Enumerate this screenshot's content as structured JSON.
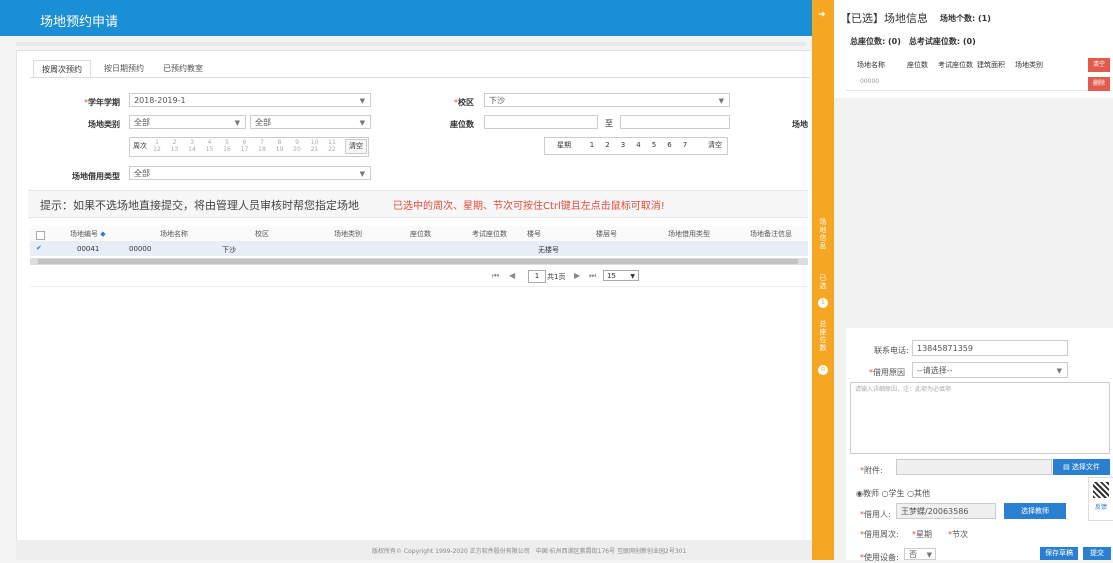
{
  "header": {
    "title": "场地预约申请"
  },
  "tabs": [
    "按周次预约",
    "按日期预约",
    "已预约教室"
  ],
  "form": {
    "semester_label": "学年学期",
    "semester_value": "2018-2019-1",
    "campus_label": "校区",
    "campus_value": "下沙",
    "venue_type_label": "场地类别",
    "venue_type_value1": "全部",
    "venue_type_value2": "全部",
    "seats_label": "座位数",
    "seats_to": "至",
    "venue_cut_label": "场地",
    "week_label": "周次",
    "week_row1": [
      "1",
      "2",
      "3",
      "4",
      "5",
      "6",
      "7",
      "8",
      "9",
      "10",
      "11"
    ],
    "week_row2": [
      "12",
      "13",
      "14",
      "15",
      "16",
      "17",
      "18",
      "19",
      "20",
      "21",
      "22"
    ],
    "week_clear": "清空",
    "weekday_label": "星期",
    "weekdays": [
      "1",
      "2",
      "3",
      "4",
      "5",
      "6",
      "7"
    ],
    "weekday_clear": "清空",
    "usage_type_label": "场地借用类型",
    "usage_type_value": "全部"
  },
  "hints": {
    "left": "提示：如果不选场地直接提交，将由管理人员审核时帮您指定场地",
    "right": "已选中的周次、星期、节次可按住Ctrl键且左点击鼠标可取消!"
  },
  "table": {
    "headers": [
      "场地编号",
      "场地名称",
      "校区",
      "场地类别",
      "座位数",
      "考试座位数",
      "楼号",
      "楼层号",
      "场地借用类型",
      "场地备注信息"
    ],
    "row": [
      "00041",
      "00000",
      "下沙",
      "",
      "",
      "",
      "无楼号",
      "",
      "",
      ""
    ]
  },
  "pager": {
    "page": "1",
    "total": "共1页",
    "size": "15"
  },
  "footer": {
    "text": "版权所有© Copyright 1999-2020 正方软件股份有限公司　中国·杭州西湖区紫霞街176号 互联网创新创业园2号301"
  },
  "strip": {
    "venue_info": "场地信息",
    "selected": "已选",
    "selected_count": "1",
    "total_seats": "总座位数",
    "total_seats_count": "0"
  },
  "right": {
    "title": "【已选】场地信息",
    "venue_count": "场地个数: (1)",
    "seats_summary": "总座位数: (0)　总考试座位数: (0)",
    "cols": [
      "场地名称",
      "座位数",
      "考试座位数",
      "建筑面积",
      "场地类别"
    ],
    "row_name": "00000",
    "clear_btn": "清空",
    "delete_btn": "删除",
    "phone_label": "联系电话:",
    "phone_value": "13845871359",
    "reason_label": "借用原因",
    "reason_value": "--请选择--",
    "reason_placeholder": "请输入详细原因，注：此项为必填项",
    "attach_label": "附件:",
    "choose_file": "选择文件",
    "roles": [
      "教师",
      "学生",
      "其他"
    ],
    "borrower_label": "借用人:",
    "borrower_value": "王梦蝶/20063586",
    "choose_teacher": "选择教师",
    "weeks_label": "借用周次:",
    "weekday_label": "星期",
    "period_label": "节次",
    "device_label": "使用设备:",
    "device_value": "否",
    "save_draft": "保存草稿",
    "submit": "提交",
    "feedback": "反馈"
  }
}
